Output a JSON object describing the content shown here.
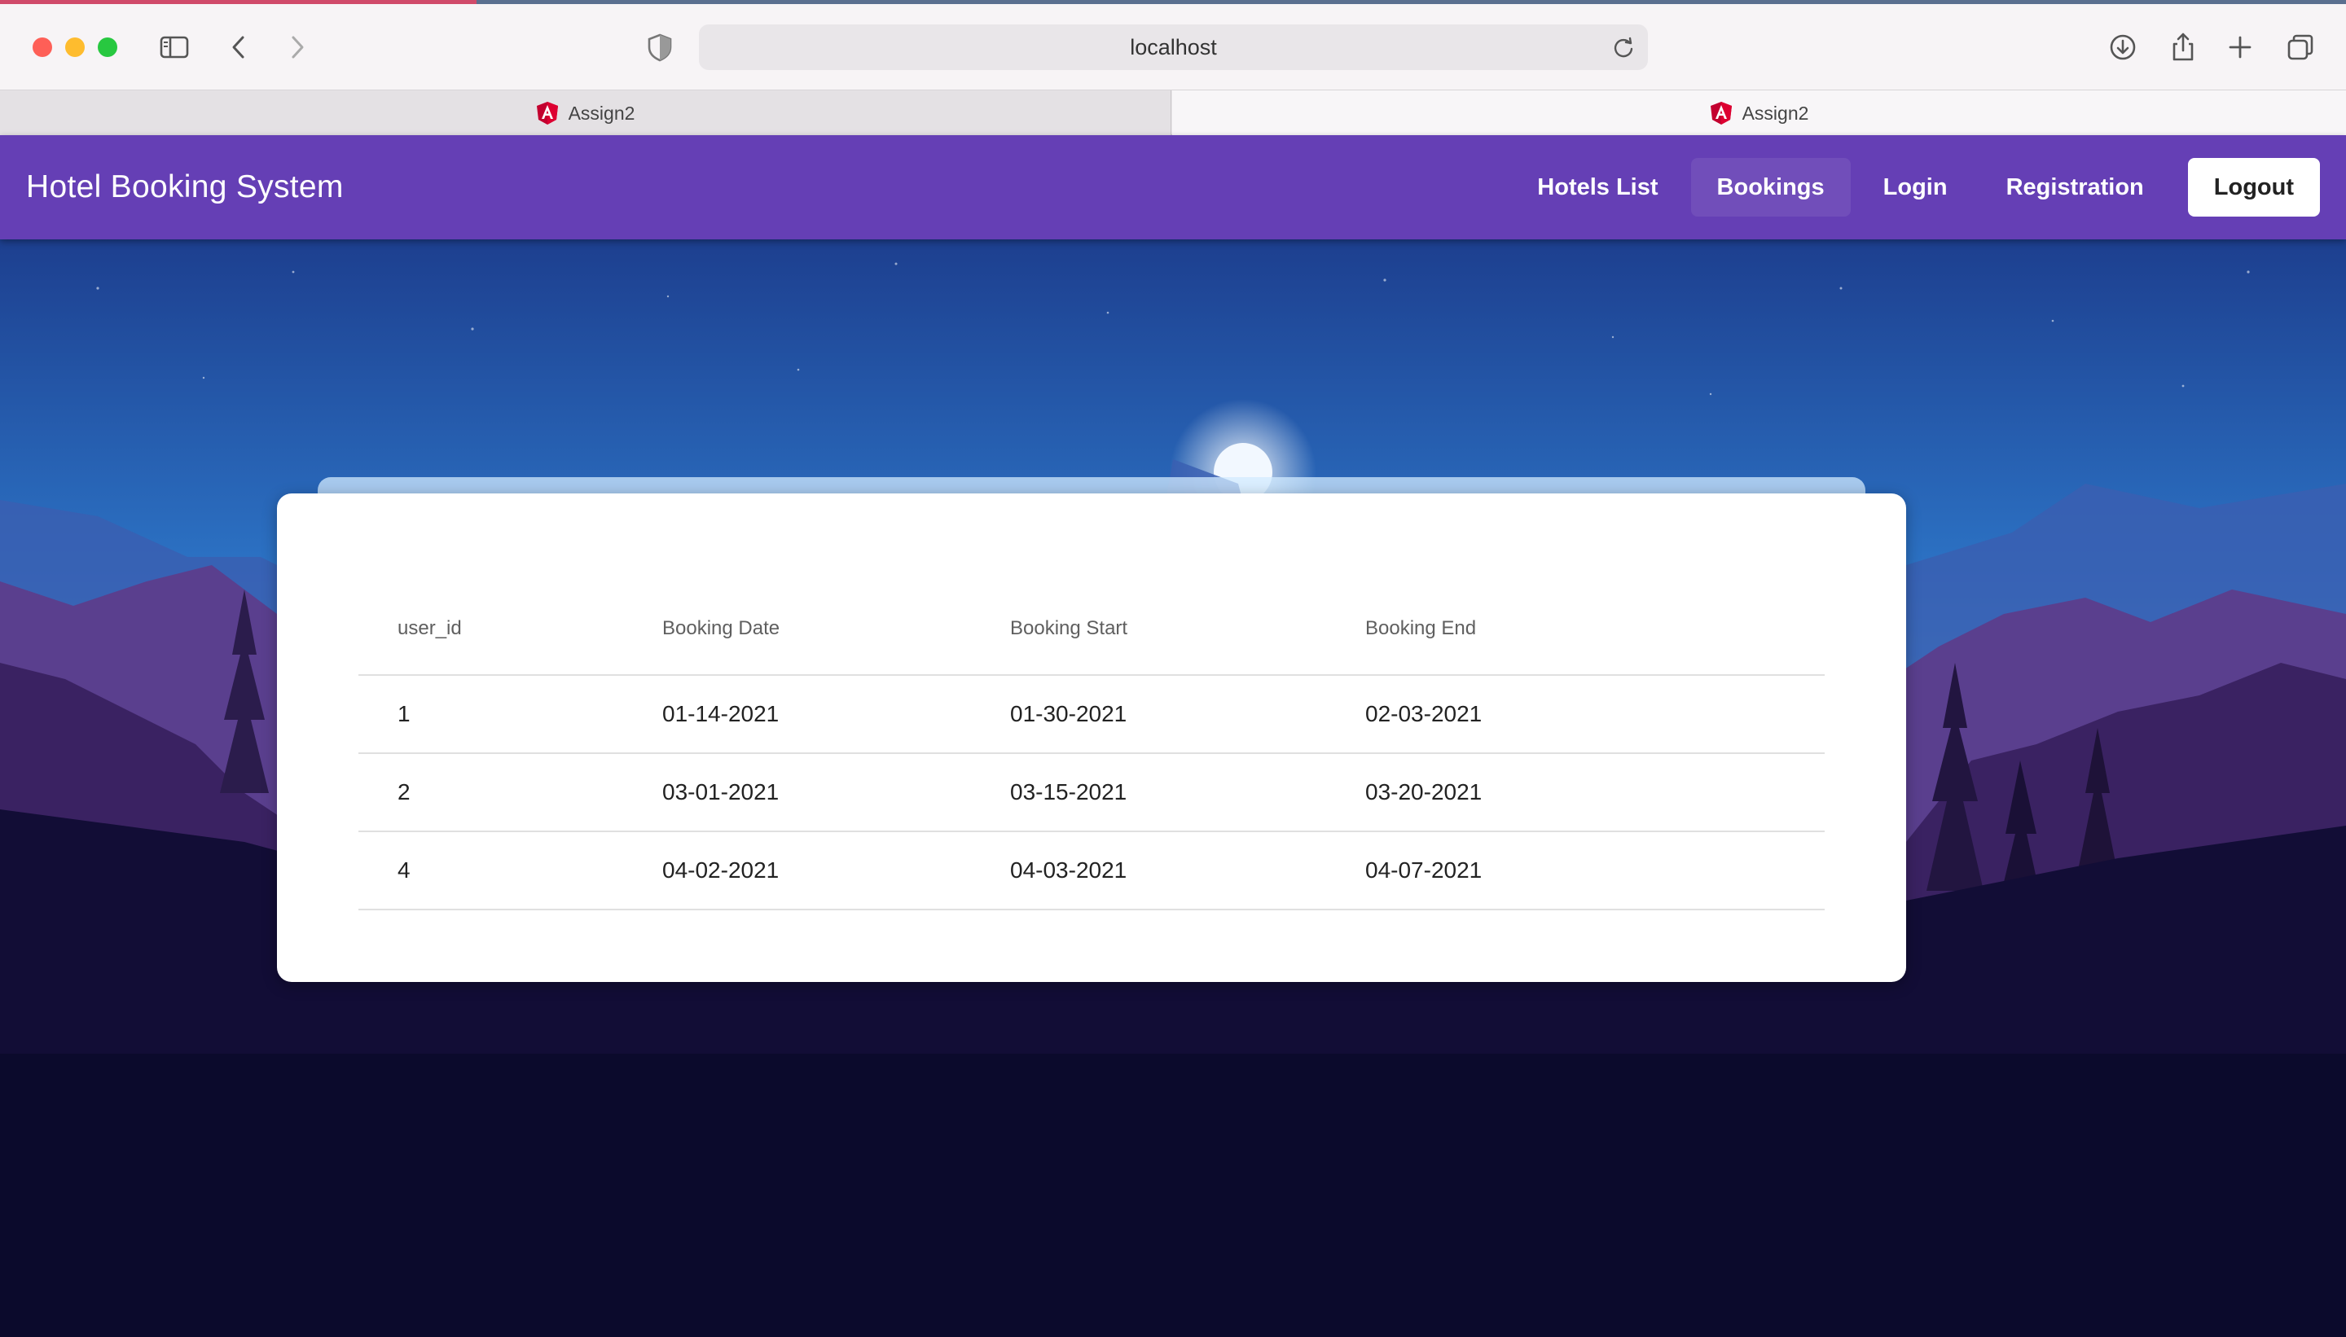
{
  "browser": {
    "address": "localhost",
    "tabs": [
      {
        "title": "Assign2",
        "icon": "angular-icon"
      },
      {
        "title": "Assign2",
        "icon": "angular-icon"
      }
    ]
  },
  "app": {
    "title": "Hotel Booking System",
    "nav": {
      "hotels_list": "Hotels List",
      "bookings": "Bookings",
      "login": "Login",
      "registration": "Registration",
      "logout": "Logout"
    }
  },
  "bookings": {
    "columns": [
      "user_id",
      "Booking Date",
      "Booking Start",
      "Booking End"
    ],
    "rows": [
      [
        "1",
        "01-14-2021",
        "01-30-2021",
        "02-03-2021"
      ],
      [
        "2",
        "03-01-2021",
        "03-15-2021",
        "03-20-2021"
      ],
      [
        "4",
        "04-02-2021",
        "04-03-2021",
        "04-07-2021"
      ]
    ]
  },
  "colors": {
    "appbar": "#653fb5",
    "logout_bg": "#ffffff"
  }
}
